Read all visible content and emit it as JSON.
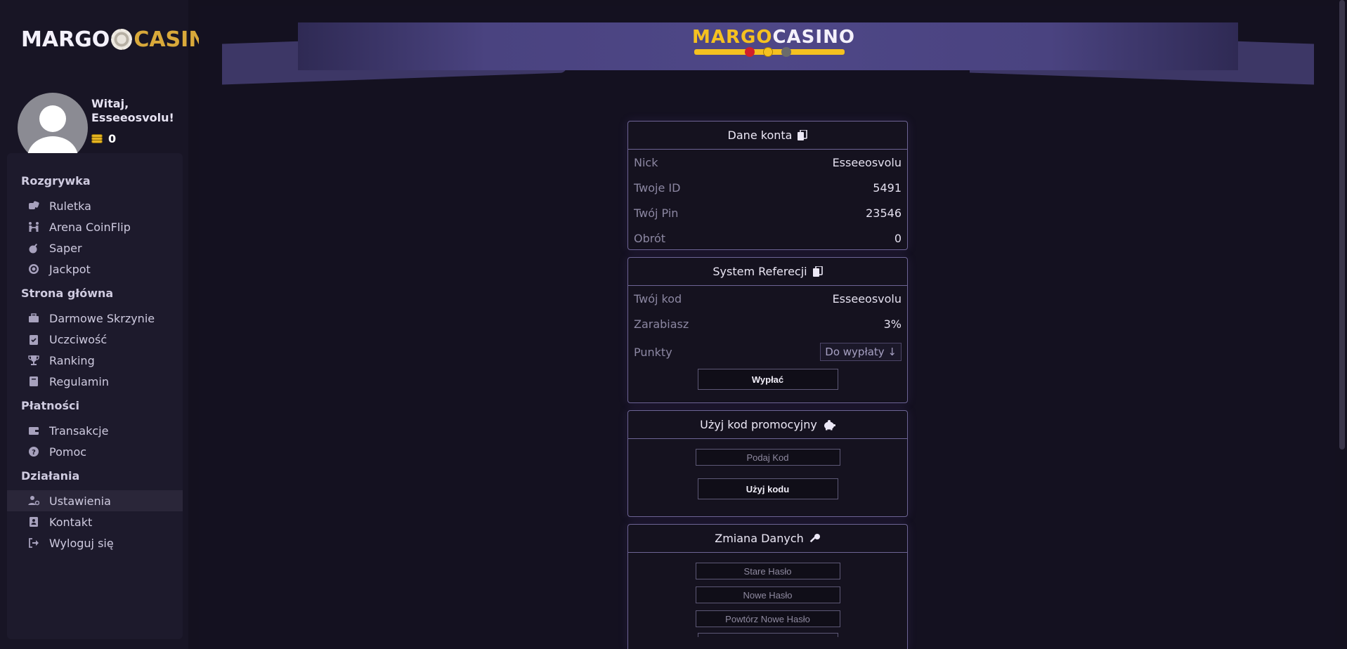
{
  "sidebar": {
    "logo": {
      "left": "MARGO",
      "right": "CASINO"
    },
    "greeting": "Witaj, Esseeosvolu!",
    "balance": "0",
    "sections": [
      {
        "heading": "Rozgrywka",
        "items": [
          {
            "label": "Ruletka",
            "icon": "dice-icon"
          },
          {
            "label": "Arena CoinFlip",
            "icon": "people-arrows-icon"
          },
          {
            "label": "Saper",
            "icon": "bomb-icon"
          },
          {
            "label": "Jackpot",
            "icon": "target-icon"
          }
        ]
      },
      {
        "heading": "Strona główna",
        "items": [
          {
            "label": "Darmowe Skrzynie",
            "icon": "briefcase-icon"
          },
          {
            "label": "Uczciwość",
            "icon": "clipboard-check-icon"
          },
          {
            "label": "Ranking",
            "icon": "trophy-icon"
          },
          {
            "label": "Regulamin",
            "icon": "book-icon"
          }
        ]
      },
      {
        "heading": "Płatności",
        "items": [
          {
            "label": "Transakcje",
            "icon": "wallet-icon"
          },
          {
            "label": "Pomoc",
            "icon": "question-circle-icon"
          }
        ]
      },
      {
        "heading": "Działania",
        "items": [
          {
            "label": "Ustawienia",
            "icon": "user-cog-icon",
            "active": true
          },
          {
            "label": "Kontakt",
            "icon": "address-book-icon"
          },
          {
            "label": "Wyloguj się",
            "icon": "sign-out-icon"
          }
        ]
      }
    ]
  },
  "banner": {
    "logo_yellow": "MARGO",
    "logo_white": "CASINO"
  },
  "account": {
    "title": "Dane konta",
    "rows": [
      {
        "label": "Nick",
        "value": "Esseeosvolu"
      },
      {
        "label": "Twoje ID",
        "value": "5491"
      },
      {
        "label": "Twój Pin",
        "value": "23546"
      },
      {
        "label": "Obrót",
        "value": "0"
      }
    ]
  },
  "referral": {
    "title": "System Referecji",
    "rows": [
      {
        "label": "Twój kod",
        "value": "Esseeosvolu"
      },
      {
        "label": "Zarabiasz",
        "value": "3%"
      }
    ],
    "points_label": "Punkty",
    "points_dropdown": "Do wypłaty ↓",
    "withdraw_button": "Wypłać"
  },
  "promo": {
    "title": "Użyj kod promocyjny",
    "placeholder": "Podaj Kod",
    "button": "Użyj kodu"
  },
  "change": {
    "title": "Zmiana Danych",
    "old_password": "Stare Hasło",
    "new_password": "Nowe Hasło",
    "repeat_password": "Powtórz Nowe Hasło"
  },
  "colors": {
    "accent_yellow": "#f5c120",
    "border_purple": "#6d6494",
    "banner": "#4e4787"
  }
}
